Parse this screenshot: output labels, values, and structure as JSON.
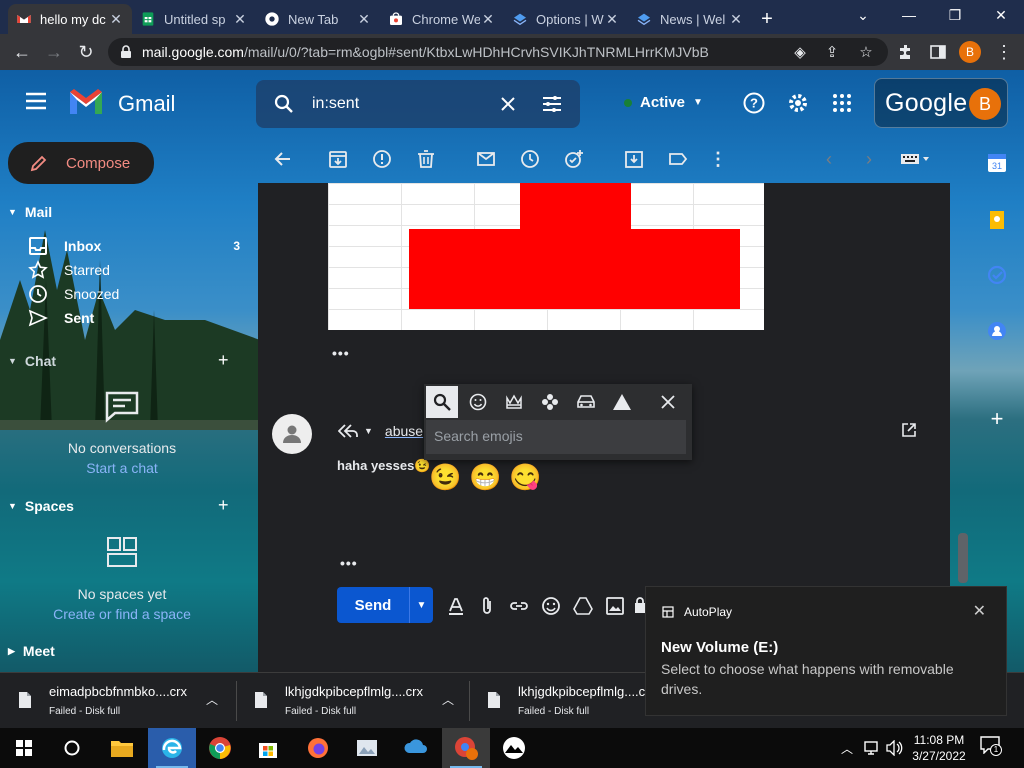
{
  "browser": {
    "tabs": [
      {
        "title": "hello my dc",
        "icon": "gmail-icon",
        "active": true
      },
      {
        "title": "Untitled sp",
        "icon": "sheets-icon",
        "active": false
      },
      {
        "title": "New Tab",
        "icon": "chrome-icon",
        "active": false
      },
      {
        "title": "Chrome We",
        "icon": "webstore-icon",
        "active": false
      },
      {
        "title": "Options | W",
        "icon": "edge-icon",
        "active": false
      },
      {
        "title": "News | Wel",
        "icon": "edge-icon",
        "active": false
      }
    ],
    "url_domain": "mail.google.com",
    "url_path": "/mail/u/0/?tab=rm&ogbl#sent/KtbxLwHDhHCrvhSVIKJhTNRMLHrrKMJVbB",
    "profile_initial": "B"
  },
  "gmail": {
    "app_name": "Gmail",
    "search_query": "in:sent",
    "status": "Active",
    "google_label": "Google",
    "avatar_initial": "B",
    "compose_label": "Compose",
    "mail_section": "Mail",
    "nav": [
      {
        "label": "Inbox",
        "count": "3",
        "icon": "inbox-icon"
      },
      {
        "label": "Starred",
        "count": "",
        "icon": "star-icon"
      },
      {
        "label": "Snoozed",
        "count": "",
        "icon": "clock-icon"
      },
      {
        "label": "Sent",
        "count": "",
        "icon": "send-icon"
      }
    ],
    "chat_section": "Chat",
    "chat_empty": "No conversations",
    "chat_link": "Start a chat",
    "spaces_section": "Spaces",
    "spaces_empty": "No spaces yet",
    "spaces_link": "Create or find a space",
    "meet_section": "Meet",
    "reply_recipient": "abuse",
    "draft_text": "haha yesses😉",
    "send_label": "Send",
    "emoji_search_placeholder": "Search emojis",
    "emoji_results": [
      "😉",
      "😁",
      "😋"
    ]
  },
  "notification": {
    "app": "AutoPlay",
    "title": "New Volume (E:)",
    "message": "Select to choose what happens with removable drives."
  },
  "downloads": [
    {
      "name": "eimadpbcbfnmbko....crx",
      "status": "Failed - Disk full"
    },
    {
      "name": "lkhjgdkpibcepflmlg....crx",
      "status": "Failed - Disk full"
    },
    {
      "name": "lkhjgdkpibcepflmlg....c",
      "status": "Failed - Disk full"
    }
  ],
  "taskbar": {
    "time": "11:08 PM",
    "date": "3/27/2022",
    "notification_count": "1"
  },
  "colors": {
    "gmail_red": "#ea4335",
    "accent_blue": "#0b57d0",
    "avatar_orange": "#e8710a",
    "sheet_red": "#ff0000"
  }
}
